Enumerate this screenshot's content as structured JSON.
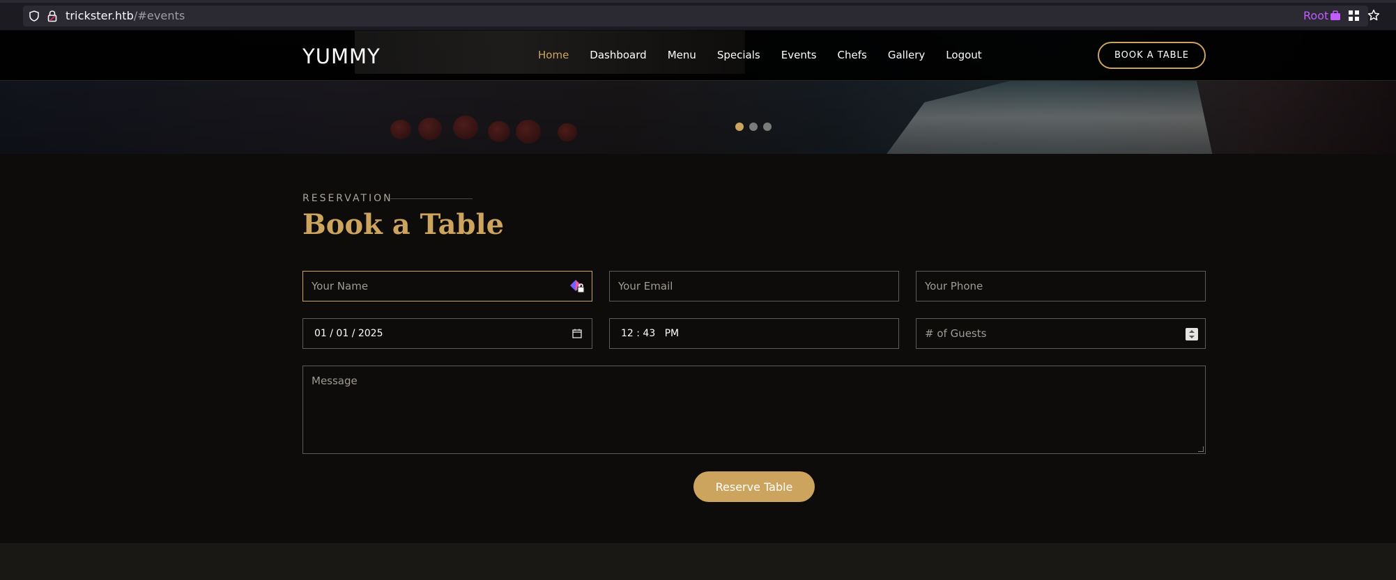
{
  "browser": {
    "url_host": "trickster.htb",
    "url_path": "/#events",
    "container_label": "Root"
  },
  "header": {
    "logo": "YUMMY",
    "nav": [
      "Home",
      "Dashboard",
      "Menu",
      "Specials",
      "Events",
      "Chefs",
      "Gallery",
      "Logout"
    ],
    "active_nav": "Home",
    "cta": "BOOK A TABLE"
  },
  "hero": {
    "slide_count": 3,
    "active_slide": 1
  },
  "reservation": {
    "eyebrow": "RESERVATION",
    "title": "Book a Table",
    "name_placeholder": "Your Name",
    "email_placeholder": "Your Email",
    "phone_placeholder": "Your Phone",
    "date_value": "01 / 01 / 2025",
    "time_value": "12 : 43   PM",
    "guests_placeholder": "# of Guests",
    "message_placeholder": "Message",
    "submit": "Reserve Table"
  },
  "colors": {
    "accent": "#cda45e",
    "background": "#0e0c0a",
    "private_browsing": "#c15cff"
  }
}
